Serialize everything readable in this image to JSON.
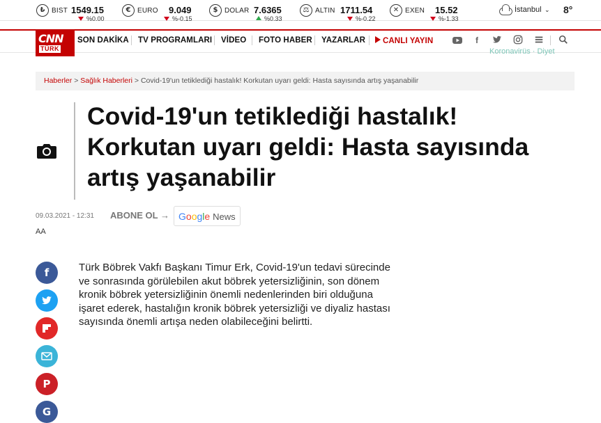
{
  "markets": [
    {
      "icon": "₺",
      "name": "BIST",
      "value": "1549.15",
      "change": "%0.00",
      "dir": "down"
    },
    {
      "icon": "€",
      "name": "EURO",
      "value": "9.049",
      "change": "%-0.15",
      "dir": "down"
    },
    {
      "icon": "$",
      "name": "DOLAR",
      "value": "7.6365",
      "change": "%0.33",
      "dir": "up"
    },
    {
      "icon": "⚖",
      "name": "ALTIN",
      "value": "1711.54",
      "change": "%-0.22",
      "dir": "down"
    },
    {
      "icon": "✕",
      "name": "EXEN",
      "value": "15.52",
      "change": "%-1.33",
      "dir": "down"
    }
  ],
  "weather": {
    "city": "İstanbul",
    "temp": "8°"
  },
  "logo": {
    "top": "CNN",
    "bottom": "TÜRK"
  },
  "nav": {
    "items": [
      "SON DAKİKA",
      "TV PROGRAMLARI",
      "VİDEO",
      "FOTO HABER",
      "YAZARLAR"
    ],
    "live": "CANLI YAYIN"
  },
  "ghost_text": "Koronavirüs · Diyet",
  "breadcrumb": {
    "home": "Haberler",
    "category": "Sağlık Haberleri",
    "sep": ">",
    "current": "Covid-19'un tetiklediği hastalık! Korkutan uyarı geldi: Hasta sayısında artış yaşanabilir"
  },
  "article": {
    "title": "Covid-19'un tetiklediği hastalık! Korkutan uyarı geldi: Hasta sayısında artış yaşanabilir",
    "date": "09.03.2021 - 12:31",
    "subscribe": "ABONE OL",
    "google_news": {
      "brand": "Google",
      "suffix": "News"
    },
    "font_size_label": "AA",
    "body": "Türk Böbrek Vakfı Başkanı Timur Erk, Covid-19'un tedavi sürecinde ve sonrasında görülebilen akut böbrek yetersizliğinin, son dönem kronik böbrek yetersizliğinin önemli nedenlerinden biri olduğuna işaret ederek, hastalığın kronik böbrek yetersizliği ve diyaliz hastası sayısında önemli artışa neden olabileceğini belirtti."
  },
  "share": [
    {
      "name": "facebook",
      "glyph": "f",
      "color": "#3b5998"
    },
    {
      "name": "twitter",
      "glyph": "t",
      "color": "#1da1f2"
    },
    {
      "name": "flipboard",
      "glyph": "F",
      "color": "#e12828"
    },
    {
      "name": "email",
      "glyph": "✉",
      "color": "#3bb4d8"
    },
    {
      "name": "pinterest",
      "glyph": "P",
      "color": "#cb2027"
    },
    {
      "name": "google",
      "glyph": "G",
      "color": "#3b5998"
    }
  ],
  "colors": {
    "brand": "#c40202",
    "link": "#c40202"
  }
}
